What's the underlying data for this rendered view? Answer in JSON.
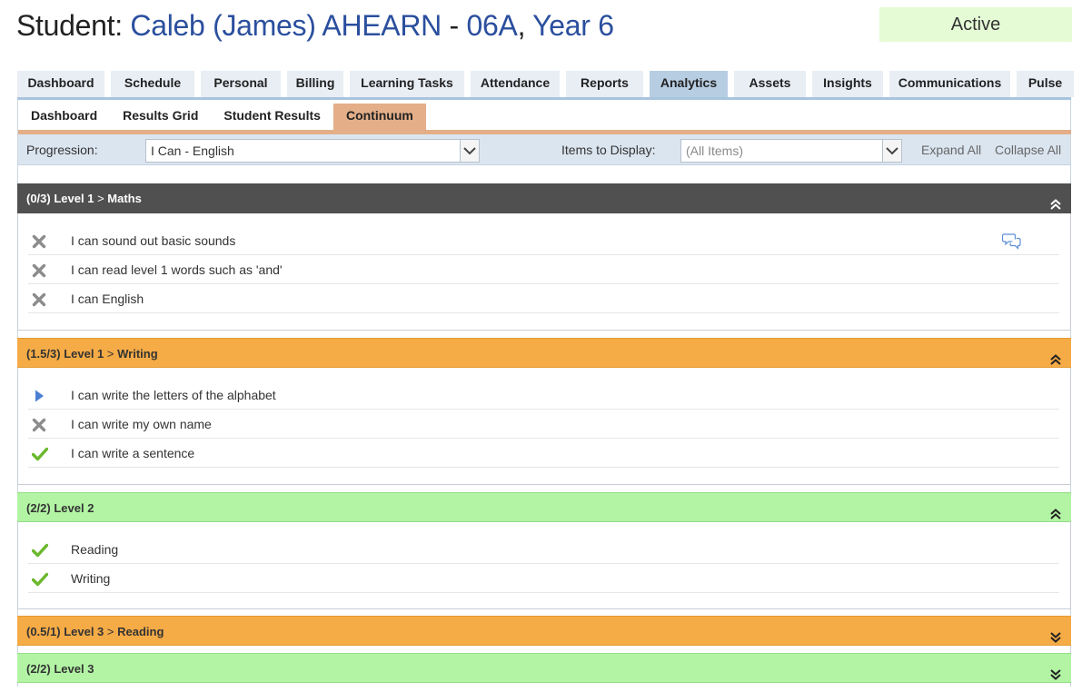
{
  "header": {
    "label": "Student:",
    "student_name": "Caleb (James) AHEARN",
    "separator": " - ",
    "form": "06A",
    "comma": ",",
    "year": "Year 6",
    "status": "Active"
  },
  "main_tabs": [
    "Dashboard",
    "Schedule",
    "Personal",
    "Billing",
    "Learning Tasks",
    "Attendance",
    "Reports",
    "Analytics",
    "Assets",
    "Insights",
    "Communications",
    "Pulse"
  ],
  "main_tabs_active": "Analytics",
  "sub_tabs": [
    "Dashboard",
    "Results Grid",
    "Student Results",
    "Continuum"
  ],
  "sub_tabs_active": "Continuum",
  "filters": {
    "progression_label": "Progression:",
    "progression_value": "I Can - English",
    "items_label": "Items to Display:",
    "items_value": "(All Items)",
    "expand_all": "Expand All",
    "collapse_all": "Collapse All"
  },
  "sections": [
    {
      "score": "(0/3)",
      "level": "Level 1",
      "gt": ">",
      "area": "Maths",
      "color": "dark",
      "expanded": true,
      "items": [
        {
          "icon": "cross-icon",
          "text": "I can sound out basic sounds",
          "comment": true
        },
        {
          "icon": "cross-icon",
          "text": "I can read level 1 words such as 'and'"
        },
        {
          "icon": "cross-icon",
          "text": "I can English"
        }
      ]
    },
    {
      "score": "(1.5/3)",
      "level": "Level 1",
      "gt": ">",
      "area": "Writing",
      "color": "orange",
      "expanded": true,
      "items": [
        {
          "icon": "in-progress-icon",
          "text": "I can write the letters of the alphabet"
        },
        {
          "icon": "cross-icon",
          "text": "I can write my own name"
        },
        {
          "icon": "check-icon",
          "text": "I can write a sentence"
        }
      ]
    },
    {
      "score": "(2/2)",
      "level": "Level 2",
      "gt": "",
      "area": "",
      "color": "green",
      "expanded": true,
      "items": [
        {
          "icon": "check-icon",
          "text": "Reading"
        },
        {
          "icon": "check-icon",
          "text": "Writing"
        }
      ]
    },
    {
      "score": "(0.5/1)",
      "level": "Level 3",
      "gt": ">",
      "area": "Reading",
      "color": "orange",
      "expanded": false,
      "items": []
    },
    {
      "score": "(2/2)",
      "level": "Level 3",
      "gt": "",
      "area": "",
      "color": "green",
      "expanded": false,
      "items": []
    }
  ],
  "colors": {
    "accent_blue": "#2b4f9e",
    "status_bg": "#e5fbd6",
    "active_tab": "#b7cde2",
    "active_subtab": "#e3ae88",
    "dark_section": "#505050",
    "orange_section": "#f5ab46",
    "green_section": "#b2f4a4"
  }
}
